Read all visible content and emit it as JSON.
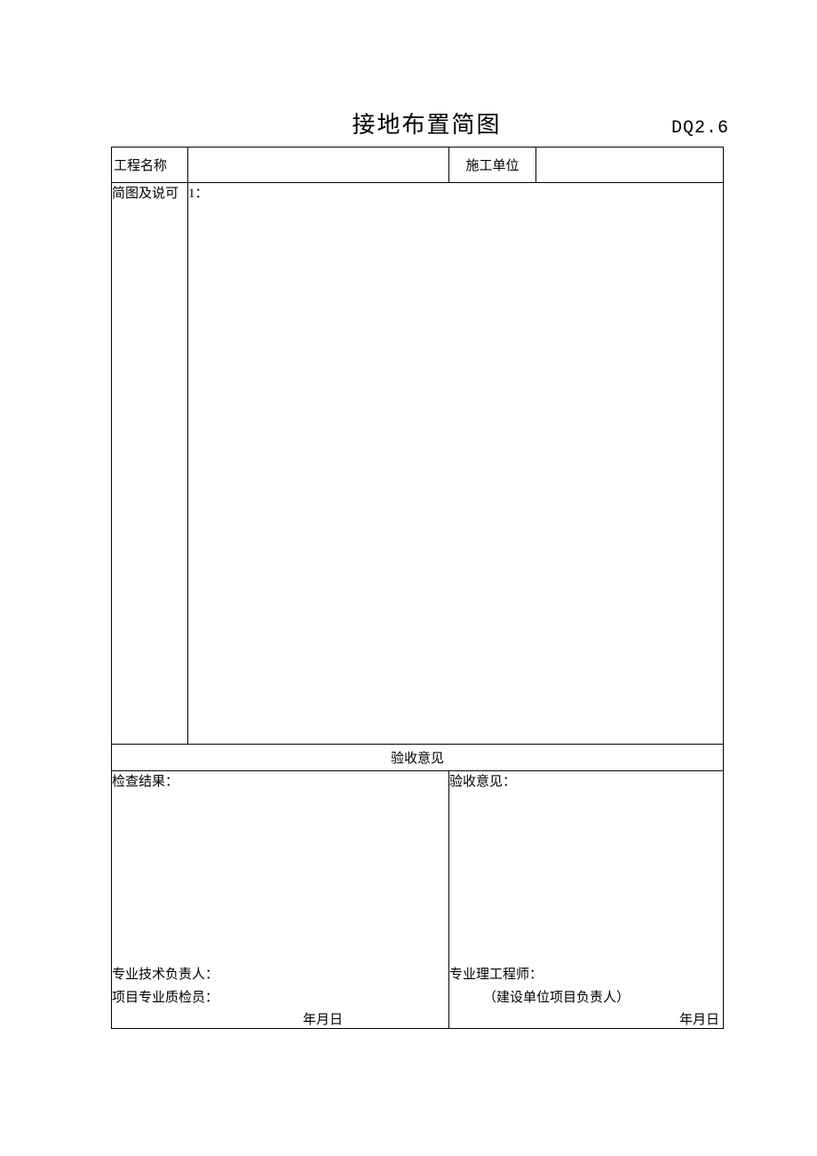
{
  "header": {
    "title": "接地布置简图",
    "doc_code": "DQ2.6"
  },
  "row1": {
    "label_project": "工程名称",
    "value_project": "",
    "label_contractor": "施工单位",
    "value_contractor": ""
  },
  "diagram": {
    "label": "简图及说可",
    "scale_prefix": "1："
  },
  "opinion_header": "验收意见",
  "left_panel": {
    "heading": "检查结果：",
    "sig1": "专业技术负责人：",
    "sig2": "项目专业质检员：",
    "date": "年月日"
  },
  "right_panel": {
    "heading": "验收意见：",
    "sig1": "专业理工程师：",
    "sub": "（建设单位项目负责人）",
    "date": "年月日"
  }
}
